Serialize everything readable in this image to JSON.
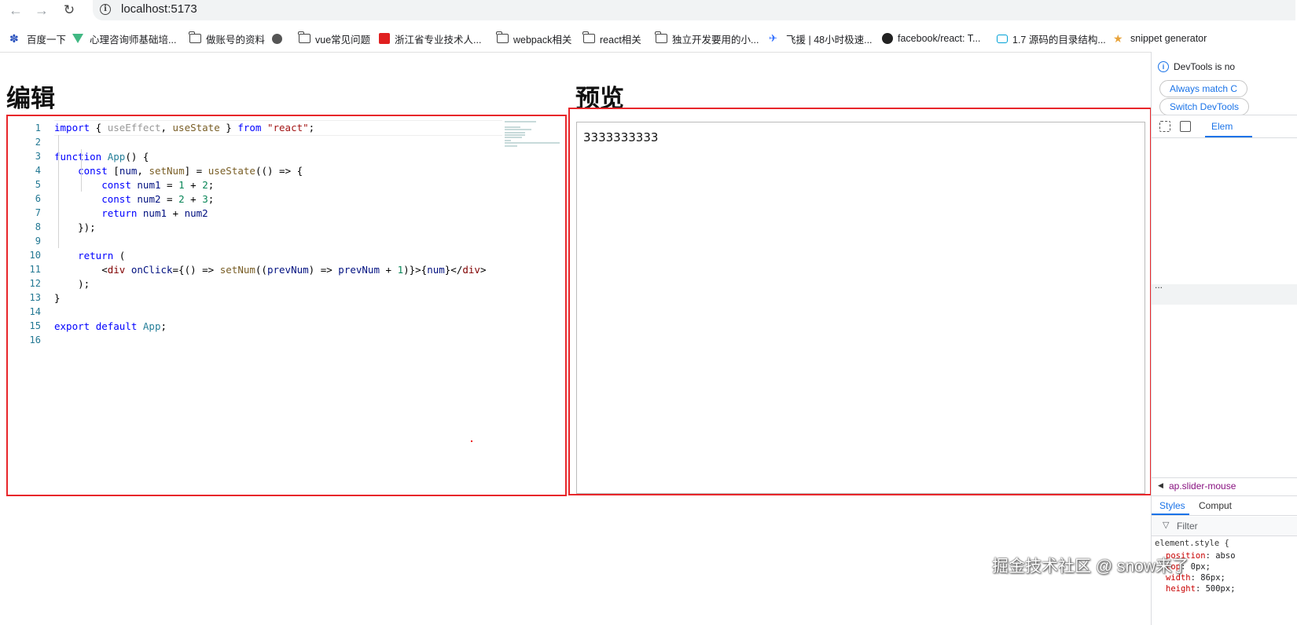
{
  "browser": {
    "url": "localhost:5173",
    "bookmarks": [
      {
        "label": "百度一下",
        "icon": "baidu-paw-icon"
      },
      {
        "label": "心理咨询师基础培...",
        "icon": "vue-logo-icon"
      },
      {
        "label": "做账号的资料",
        "icon": "folder-icon"
      },
      {
        "label": "",
        "icon": "globe-icon"
      },
      {
        "label": "vue常见问题",
        "icon": "folder-icon"
      },
      {
        "label": "浙江省专业技术人...",
        "icon": "red-square-icon"
      },
      {
        "label": "webpack相关",
        "icon": "folder-icon"
      },
      {
        "label": "react相关",
        "icon": "folder-icon"
      },
      {
        "label": "独立开发要用的小...",
        "icon": "folder-icon"
      },
      {
        "label": "飞援 | 48小时极速...",
        "icon": "feiyuan-icon"
      },
      {
        "label": "facebook/react: T...",
        "icon": "github-icon"
      },
      {
        "label": "1.7 源码的目录结构...",
        "icon": "bilibili-tv-icon"
      },
      {
        "label": "snippet generator",
        "icon": "star-icon"
      }
    ]
  },
  "page": {
    "editor_title": "编辑",
    "preview_title": "预览",
    "preview_output": "3333333333"
  },
  "editor": {
    "line_numbers": [
      "1",
      "2",
      "3",
      "4",
      "5",
      "6",
      "7",
      "8",
      "9",
      "10",
      "11",
      "12",
      "13",
      "14",
      "15",
      "16"
    ],
    "lines": [
      "import { useEffect, useState } from \"react\";",
      "",
      "function App() {",
      "    const [num, setNum] = useState(() => {",
      "        const num1 = 1 + 2;",
      "        const num2 = 2 + 3;",
      "        return num1 + num2",
      "    });",
      "",
      "    return (",
      "        <div onClick={() => setNum((prevNum) => prevNum + 1)}>{num}</div>",
      "    );",
      "}",
      "",
      "export default App;",
      ""
    ]
  },
  "devtools": {
    "notice": "DevTools is no",
    "btn_match": "Always match C",
    "btn_switch": "Switch DevTools",
    "tab_elements": "Elem",
    "ellipsis": "...",
    "breadcrumb": "ap.slider-mouse",
    "tab_styles": "Styles",
    "tab_computed": "Comput",
    "filter_placeholder": "Filter",
    "style_selector": "element.style {",
    "style_lines": [
      {
        "prop": "position",
        "val": "abso"
      },
      {
        "prop": "top",
        "val": "0px;"
      },
      {
        "prop": "width",
        "val": "86px;"
      },
      {
        "prop": "height",
        "val": "500px;"
      }
    ]
  },
  "watermark": "掘金技术社区 @ snow来了",
  "colors": {
    "highlight_border": "#e8262a",
    "keyword": "#0000ff",
    "string": "#a31515",
    "number": "#098658"
  }
}
